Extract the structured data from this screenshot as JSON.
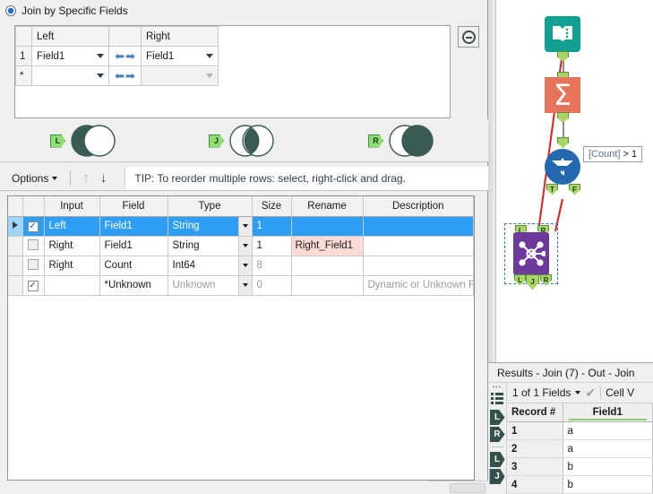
{
  "config": {
    "join_mode_label": "Join by Specific Fields",
    "join_grid": {
      "headers": {
        "num": "",
        "left": "Left",
        "mid": "",
        "right": "Right"
      },
      "rows": [
        {
          "num": "1",
          "left": "Field1",
          "right": "Field1",
          "right_disabled": false
        },
        {
          "num": "*",
          "left": "",
          "right": "",
          "right_disabled": true
        }
      ]
    },
    "remove_button_label": "remove-row",
    "venn": [
      {
        "anchor": "L",
        "caption": "left-only-venn"
      },
      {
        "anchor": "J",
        "caption": "inner-join-venn"
      },
      {
        "anchor": "R",
        "caption": "right-only-venn"
      }
    ],
    "options_bar": {
      "options_label": "Options",
      "move_up_label": "↑",
      "move_down_label": "↓",
      "tip_text": "TIP: To reorder multiple rows: select, right-click and drag."
    },
    "field_grid": {
      "headers": [
        "",
        "",
        "Input",
        "Field",
        "Type",
        "Size",
        "Rename",
        "Description"
      ],
      "rows": [
        {
          "selected": true,
          "checked": true,
          "input": "Left",
          "field": "Field1",
          "type": "String",
          "type_muted": false,
          "size": "1",
          "size_muted": false,
          "rename": "",
          "rename_highlight": false,
          "description": "",
          "desc_muted": false
        },
        {
          "selected": false,
          "checked": false,
          "input": "Right",
          "field": "Field1",
          "type": "String",
          "type_muted": false,
          "size": "1",
          "size_muted": false,
          "rename": "Right_Field1",
          "rename_highlight": true,
          "description": "",
          "desc_muted": false
        },
        {
          "selected": false,
          "checked": false,
          "input": "Right",
          "field": "Count",
          "type": "Int64",
          "type_muted": false,
          "size": "8",
          "size_muted": true,
          "rename": "",
          "rename_highlight": false,
          "description": "",
          "desc_muted": false
        },
        {
          "selected": false,
          "checked": true,
          "input": "",
          "field": "*Unknown",
          "type": "Unknown",
          "type_muted": true,
          "size": "0",
          "size_muted": true,
          "rename": "",
          "rename_highlight": false,
          "description": "Dynamic or Unknown Fields",
          "desc_muted": true
        }
      ]
    }
  },
  "canvas": {
    "tools": [
      {
        "name": "input-data-tool",
        "icon": "book-icon",
        "color": "#11a091"
      },
      {
        "name": "summarize-tool",
        "icon": "sigma-icon",
        "glyph": "Σ",
        "color": "#e5745a"
      },
      {
        "name": "filter-tool",
        "icon": "filter-icon",
        "color": "#2468b0"
      },
      {
        "name": "join-tool",
        "icon": "join-icon",
        "color": "#6d3a9c",
        "selected": true
      }
    ],
    "filter_annotation": {
      "field": "[Count]",
      "rest": " > 1"
    },
    "join_anchors_in": [
      "L",
      "R"
    ],
    "join_anchors_out": [
      "L",
      "J",
      "R"
    ],
    "filter_anchors_out": [
      "T",
      "F"
    ]
  },
  "results": {
    "title": "Results - Join (7) - Out - Join",
    "toolbar": {
      "fields_selector": "1 of 1 Fields",
      "check_glyph": "✔",
      "cell_viewer_label": "Cell V"
    },
    "rail_anchors": [
      {
        "label": "L",
        "kind": "in",
        "highlight": false
      },
      {
        "label": "R",
        "kind": "in",
        "highlight": false
      },
      {
        "label": "L",
        "kind": "out",
        "highlight": false
      },
      {
        "label": "J",
        "kind": "out",
        "highlight": true
      }
    ],
    "grid": {
      "columns": [
        "Record #",
        "Field1"
      ],
      "rows": [
        {
          "record": "1",
          "field1": "a"
        },
        {
          "record": "2",
          "field1": "a"
        },
        {
          "record": "3",
          "field1": "b"
        },
        {
          "record": "4",
          "field1": "b"
        }
      ]
    }
  }
}
